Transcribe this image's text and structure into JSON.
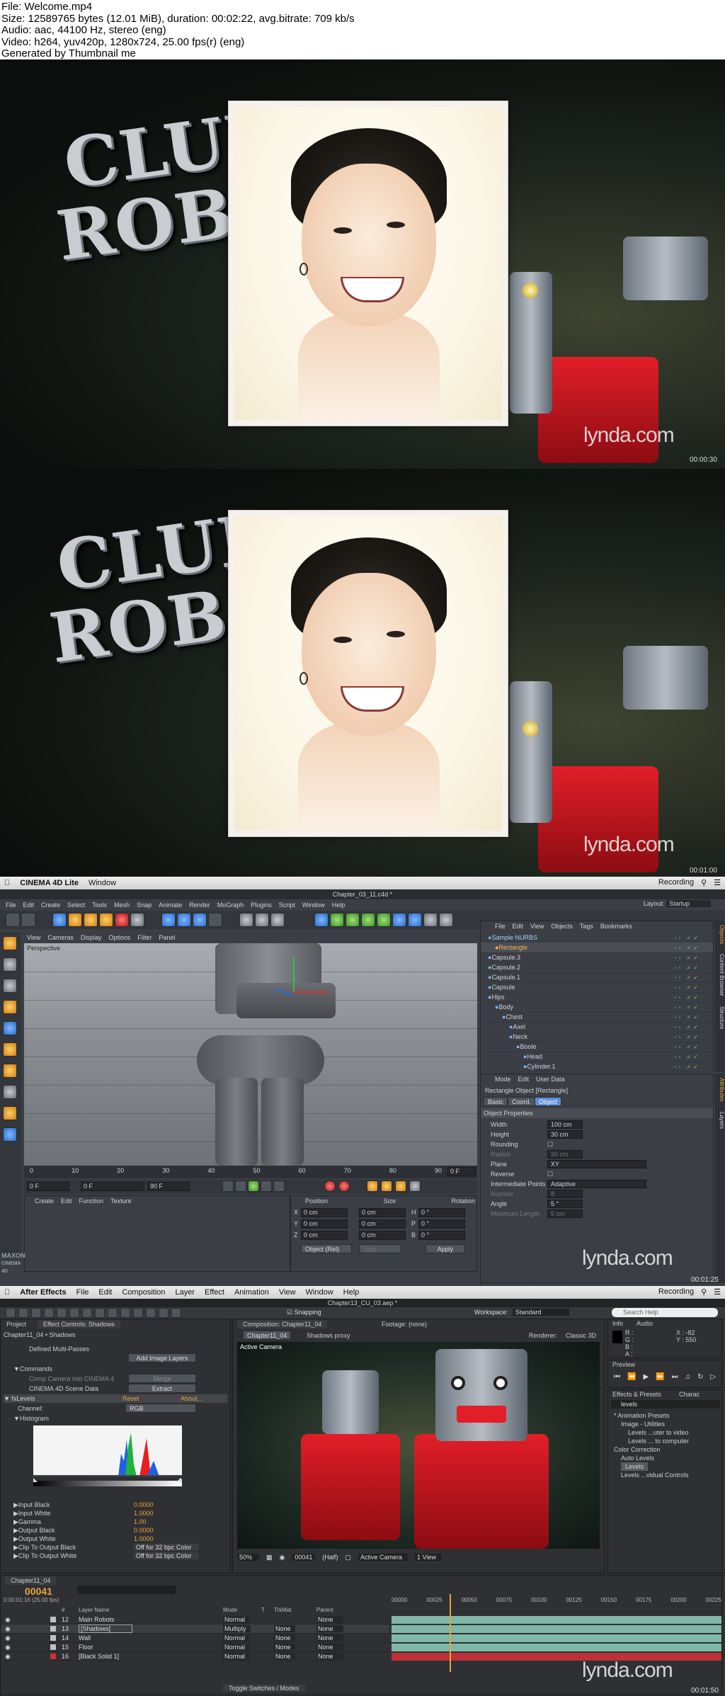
{
  "header": {
    "file": "File: Welcome.mp4",
    "size": "Size: 12589765 bytes (12.01 MiB), duration: 00:02:22, avg.bitrate: 709 kb/s",
    "audio": "Audio: aac, 44100 Hz, stereo (eng)",
    "video": "Video: h264, yuv420p, 1280x724, 25.00 fps(r) (eng)",
    "generated": "Generated by Thumbnail me"
  },
  "frames": {
    "f1": {
      "logo": "lynda.com",
      "timecode": "00:00:30",
      "club_line1": "CLUB",
      "club_line2": "ROBO"
    },
    "f2": {
      "logo": "lynda.com",
      "timecode": "00:01:00",
      "club_line1": "CLUB",
      "club_line2": "ROBO"
    },
    "f3": {
      "logo": "lynda.com",
      "timecode": "00:01:25"
    },
    "f4": {
      "logo": "lynda.com",
      "timecode": "00:01:50"
    }
  },
  "c4d": {
    "app_name": "CINEMA 4D Lite",
    "window_menu": "Window",
    "recording": "Recording",
    "doc_title": "Chapter_03_11.c4d *",
    "layout_label": "Layout:",
    "layout_value": "Startup",
    "menu": [
      "File",
      "Edit",
      "Create",
      "Select",
      "Tools",
      "Mesh",
      "Snap",
      "Animate",
      "Render",
      "MoGraph",
      "Plugins",
      "Script",
      "Window",
      "Help"
    ],
    "view_menu": [
      "View",
      "Cameras",
      "Display",
      "Options",
      "Filter",
      "Panel"
    ],
    "perspective": "Perspective",
    "obj_menu": [
      "File",
      "Edit",
      "View",
      "Objects",
      "Tags",
      "Bookmarks"
    ],
    "objects": [
      "Sample NURBS",
      "Rectangle",
      "Capsule.3",
      "Capsule.2",
      "Capsule.1",
      "Capsule",
      "Hips",
      "Body",
      "Chest",
      "Axel",
      "Neck",
      "Boole",
      "Head",
      "Cylinder.1"
    ],
    "attr_menu": [
      "Mode",
      "Edit",
      "User Data"
    ],
    "attr_title": "Rectangle Object [Rectangle]",
    "attr_tabs": [
      "Basic",
      "Coord.",
      "Object"
    ],
    "obj_props": "Object Properties",
    "props": [
      {
        "label": "Width",
        "value": "100 cm"
      },
      {
        "label": "Height",
        "value": "30 cm"
      },
      {
        "label": "Rounding",
        "value": ""
      },
      {
        "label": "Radius",
        "value": "30 cm"
      },
      {
        "label": "Plane",
        "value": "XY"
      },
      {
        "label": "Reverse",
        "value": ""
      },
      {
        "label": "Intermediate Points",
        "value": "Adaptive"
      },
      {
        "label": "Number",
        "value": "8"
      },
      {
        "label": "Angle",
        "value": "5 °"
      },
      {
        "label": "Maximum Length",
        "value": "5 cm"
      }
    ],
    "ruler": [
      "0",
      "10",
      "20",
      "30",
      "40",
      "50",
      "60",
      "70",
      "80",
      "90"
    ],
    "frame_current": "0 F",
    "frame_a": "0 F",
    "frame_b": "90 F",
    "frame_c": "90 F",
    "frame_end": "0 F",
    "coord_menu": [
      "Create",
      "Edit",
      "Function",
      "Texture"
    ],
    "coord_headers": [
      "Position",
      "Size",
      "Rotation"
    ],
    "coord_rows": [
      {
        "axis": "X",
        "pos": "0 cm",
        "size": "0 cm",
        "rot_axis": "H",
        "rot": "0 °"
      },
      {
        "axis": "Y",
        "pos": "0 cm",
        "size": "0 cm",
        "rot_axis": "P",
        "rot": "0 °"
      },
      {
        "axis": "Z",
        "pos": "0 cm",
        "size": "0 cm",
        "rot_axis": "B",
        "rot": "0 °"
      }
    ],
    "coord_mode": "Object (Rel)",
    "coord_size_mode": "Size",
    "apply": "Apply",
    "side_tabs": [
      "Objects",
      "Content Browser",
      "Structure"
    ],
    "attr_side_tabs": [
      "Attributes",
      "Layers"
    ],
    "maxon_brand": "MAXON",
    "cinema_brand": "CINEMA 4D"
  },
  "ae": {
    "app_name": "After Effects",
    "menu": [
      "File",
      "Edit",
      "Composition",
      "Layer",
      "Effect",
      "Animation",
      "View",
      "Window",
      "Help"
    ],
    "recording": "Recording",
    "snapping": "Snapping",
    "doc_title": "Chapter13_CU_03.aep *",
    "workspace_label": "Workspace:",
    "workspace_value": "Standard",
    "search_help": "Search Help",
    "project_tab": "Project",
    "effect_controls_tab": "Effect Controls: Shadows",
    "layer_path": "Chapter11_04 • Shadows",
    "defined_multi": "Defined Multi-Passes",
    "add_image_layers": "Add Image Layers",
    "commands": "Commands",
    "comp_camera": "Comp Camera into CINEMA 4",
    "merge": "Merge",
    "c4d_scene_data": "CINEMA 4D Scene Data",
    "extract": "Extract",
    "levels": "Levels",
    "reset": "Reset",
    "about": "About...",
    "channel_label": "Channel:",
    "channel_value": "RGB",
    "histogram": "Histogram",
    "level_props": [
      {
        "label": "Input Black",
        "value": "0.0000"
      },
      {
        "label": "Input White",
        "value": "1.0000"
      },
      {
        "label": "Gamma",
        "value": "1.00"
      },
      {
        "label": "Output Black",
        "value": "0.0000"
      },
      {
        "label": "Output White",
        "value": "1.0000"
      },
      {
        "label": "Clip To Output Black",
        "value": "Off for 32 bpc Color"
      },
      {
        "label": "Clip To Output White",
        "value": "Off for 32 bpc Color"
      }
    ],
    "comp_tab": "Composition: Chapter11_04",
    "footage_tab": "Footage: (none)",
    "comp_breadcrumb_1": "Chapter11_04",
    "comp_breadcrumb_2": "Shadows proxy",
    "renderer_label": "Renderer:",
    "renderer_value": "Classic 3D",
    "active_camera": "Active Camera",
    "zoom": "50%",
    "comp_time": "00041",
    "resolution": "(Half)",
    "camera_view": "Active Camera",
    "views": "1 View",
    "info_tab": "Info",
    "audio_tab": "Audio",
    "info_r": "R :",
    "info_g": "G :",
    "info_b": "B :",
    "info_a": "A :",
    "info_x": "X : -82",
    "info_y": "Y : 550",
    "preview_tab": "Preview",
    "effects_tab": "Effects & Presets",
    "character_tab": "Charac",
    "ep_search": "levels",
    "ep_tree": [
      "* Animation Presets",
      "Image - Utilities",
      "Levels ...uter to video",
      "Levels ... to computer",
      "Color Correction",
      "Auto Levels",
      "Levels",
      "Levels ...vidual Controls"
    ],
    "timeline_tab": "Chapter11_04",
    "timecode": "00041",
    "timecode_sub": "0:00:01:16 (25.00 fps)",
    "layer_header": [
      "#",
      "Layer Name",
      "Mode",
      "T",
      "TrkMat",
      "Parent"
    ],
    "layers": [
      {
        "num": "12",
        "name": "Main Robots",
        "mode": "Normal",
        "trk": "",
        "parent": "None",
        "color": "#c0c0c0"
      },
      {
        "num": "13",
        "name": "[Shadows]",
        "mode": "Multiply",
        "trk": "None",
        "parent": "None",
        "color": "#c0c0c0"
      },
      {
        "num": "14",
        "name": "Wall",
        "mode": "Normal",
        "trk": "None",
        "parent": "None",
        "color": "#c0c0c0"
      },
      {
        "num": "15",
        "name": "Floor",
        "mode": "Normal",
        "trk": "None",
        "parent": "None",
        "color": "#c0c0c0"
      },
      {
        "num": "16",
        "name": "[Black Solid 1]",
        "mode": "Normal",
        "trk": "None",
        "parent": "None",
        "color": "#d03030"
      }
    ],
    "ruler": [
      "00000",
      "00025",
      "00050",
      "00075",
      "00100",
      "00125",
      "00150",
      "00175",
      "00200",
      "00225"
    ],
    "toggle_switches": "Toggle Switches / Modes"
  },
  "colors": {
    "c4d_bg": "#3b3e44",
    "ae_bg": "#2f3033",
    "ae_value": "#e8a43a",
    "c4d_selected": "#5d8fd6",
    "track_teal": "#7fb8a8",
    "track_red": "#c03038"
  }
}
